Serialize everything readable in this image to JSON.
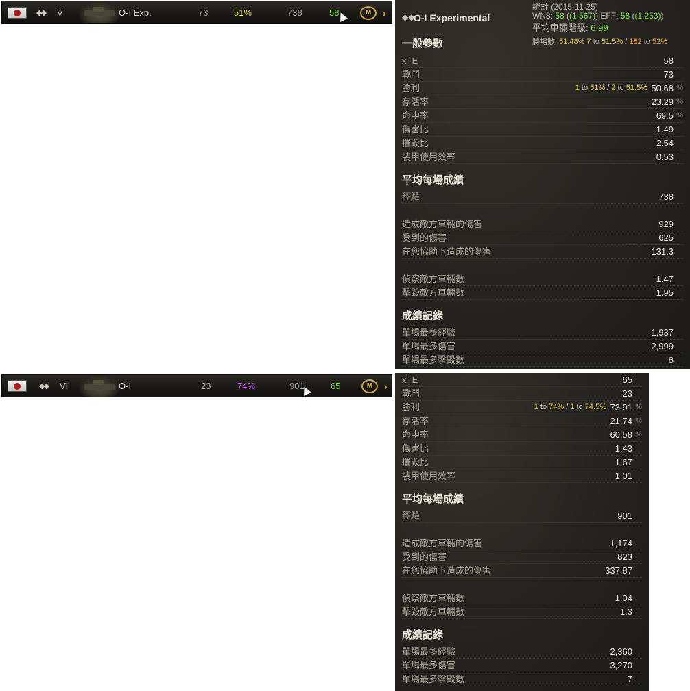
{
  "rows": [
    {
      "tier": "V",
      "name": "O-I Exp.",
      "battles": "73",
      "winrate": "51%",
      "xp": "738",
      "rating": "58",
      "mastery": "M",
      "winrate_color": "#e6d84a",
      "rating_color": "#7ee04a"
    },
    {
      "tier": "VI",
      "name": "O-I",
      "battles": "23",
      "winrate": "74%",
      "xp": "901",
      "rating": "65",
      "mastery": "M",
      "winrate_color": "#c46cf0",
      "rating_color": "#7ee04a"
    }
  ],
  "panel1": {
    "title": "O-I Experimental",
    "stats_label": "統計",
    "stats_date": "(2015-11-25)",
    "wn8_label": "WN8:",
    "wn8": "58",
    "wn8_paren": "(1,567)",
    "eff_label": "EFF:",
    "eff": "58",
    "eff_paren": "(1,253)",
    "avg_tier_label": "平均車輛階級:",
    "avg_tier": "6.99",
    "wins_label": "勝場數:",
    "wins_pct": "51.48%",
    "wins_t1_n": "7",
    "wins_t1_to": "to",
    "wins_t1_p": "51.5%",
    "wins_t2_n": "182",
    "wins_t2_to": "to",
    "wins_t2_p": "52%",
    "general": "一般參數",
    "xte": "58",
    "battles": "73",
    "win_extra_a": "1",
    "win_extra_a_p": "51%",
    "win_extra_b": "2",
    "win_extra_b_p": "51.5%",
    "wins": "50.68",
    "survival": "23.29",
    "hit": "69.5",
    "dmg_ratio": "1.49",
    "kill_ratio": "2.54",
    "armor_eff": "0.53",
    "avg_section": "平均每場成績",
    "exp": "738",
    "dmg_dealt": "929",
    "dmg_recv": "625",
    "assist": "131.3",
    "spotted": "1.47",
    "destroyed": "1.95",
    "record_section": "成績記錄",
    "max_xp": "1,937",
    "max_dmg": "2,999",
    "max_kills": "8"
  },
  "panel2": {
    "xte": "65",
    "battles": "23",
    "win_extra_a": "1",
    "win_extra_a_p": "74%",
    "win_extra_b": "1",
    "win_extra_b_p": "74.5%",
    "wins": "73.91",
    "survival": "21.74",
    "hit": "60.58",
    "dmg_ratio": "1.43",
    "kill_ratio": "1.67",
    "armor_eff": "1.01",
    "avg_section": "平均每場成績",
    "exp": "901",
    "dmg_dealt": "1,174",
    "dmg_recv": "823",
    "assist": "337.87",
    "spotted": "1.04",
    "destroyed": "1.3",
    "record_section": "成績記錄",
    "max_xp": "2,360",
    "max_dmg": "3,270",
    "max_kills": "7"
  },
  "labels": {
    "xte": "xTE",
    "battles": "戰鬥",
    "wins": "勝利",
    "survival": "存活率",
    "hit": "命中率",
    "dmg_ratio": "傷害比",
    "kill_ratio": "摧毀比",
    "armor_eff": "裝甲使用效率",
    "exp": "經驗",
    "dmg_dealt": "造成敵方車輛的傷害",
    "dmg_recv": "受到的傷害",
    "assist": "在您協助下造成的傷害",
    "spotted": "偵察敵方車輛數",
    "destroyed": "擊毀敵方車輛數",
    "max_xp": "單場最多經驗",
    "max_dmg": "單場最多傷害",
    "max_kills": "單場最多擊毀數",
    "pct": "%",
    "to": "to",
    "slash": "/"
  },
  "icons": {
    "flag": "japan-flag-icon",
    "class": "medium-tank-icon",
    "mastery": "mastery-badge-icon",
    "arrow": "chevron-right-icon",
    "cursor": "hand-cursor-icon"
  }
}
